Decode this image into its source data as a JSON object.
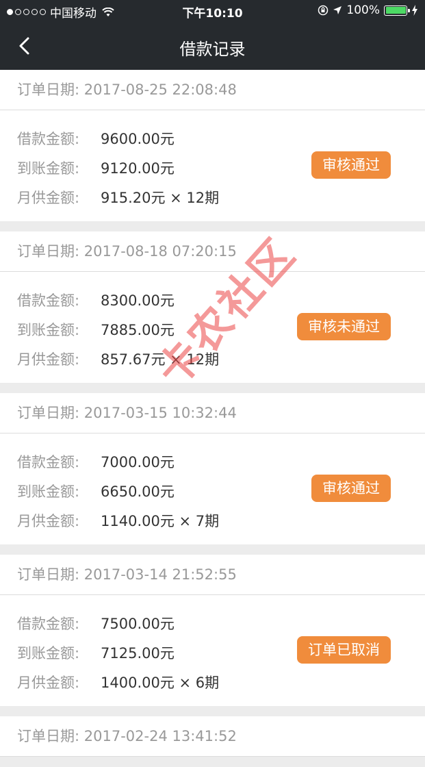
{
  "status": {
    "carrier": "中国移动",
    "time": "下午10:10",
    "battery": "100%"
  },
  "nav": {
    "title": "借款记录"
  },
  "labels": {
    "date": "订单日期:",
    "loan": "借款金额:",
    "received": "到账金额:",
    "monthly": "月供金额:"
  },
  "orders": [
    {
      "date": "2017-08-25 22:08:48",
      "loan": "9600.00元",
      "received": "9120.00元",
      "monthly": "915.20元 × 12期",
      "status": "审核通过"
    },
    {
      "date": "2017-08-18 07:20:15",
      "loan": "8300.00元",
      "received": "7885.00元",
      "monthly": "857.67元 × 12期",
      "status": "审核未通过"
    },
    {
      "date": "2017-03-15 10:32:44",
      "loan": "7000.00元",
      "received": "6650.00元",
      "monthly": "1140.00元 × 7期",
      "status": "审核通过"
    },
    {
      "date": "2017-03-14 21:52:55",
      "loan": "7500.00元",
      "received": "7125.00元",
      "monthly": "1400.00元 × 6期",
      "status": "订单已取消"
    },
    {
      "date": "2017-02-24 13:41:52"
    }
  ],
  "watermark": "卡农社区",
  "colors": {
    "bar": "#262a2e",
    "badge": "#f08c3c",
    "battery": "#4cd964"
  }
}
